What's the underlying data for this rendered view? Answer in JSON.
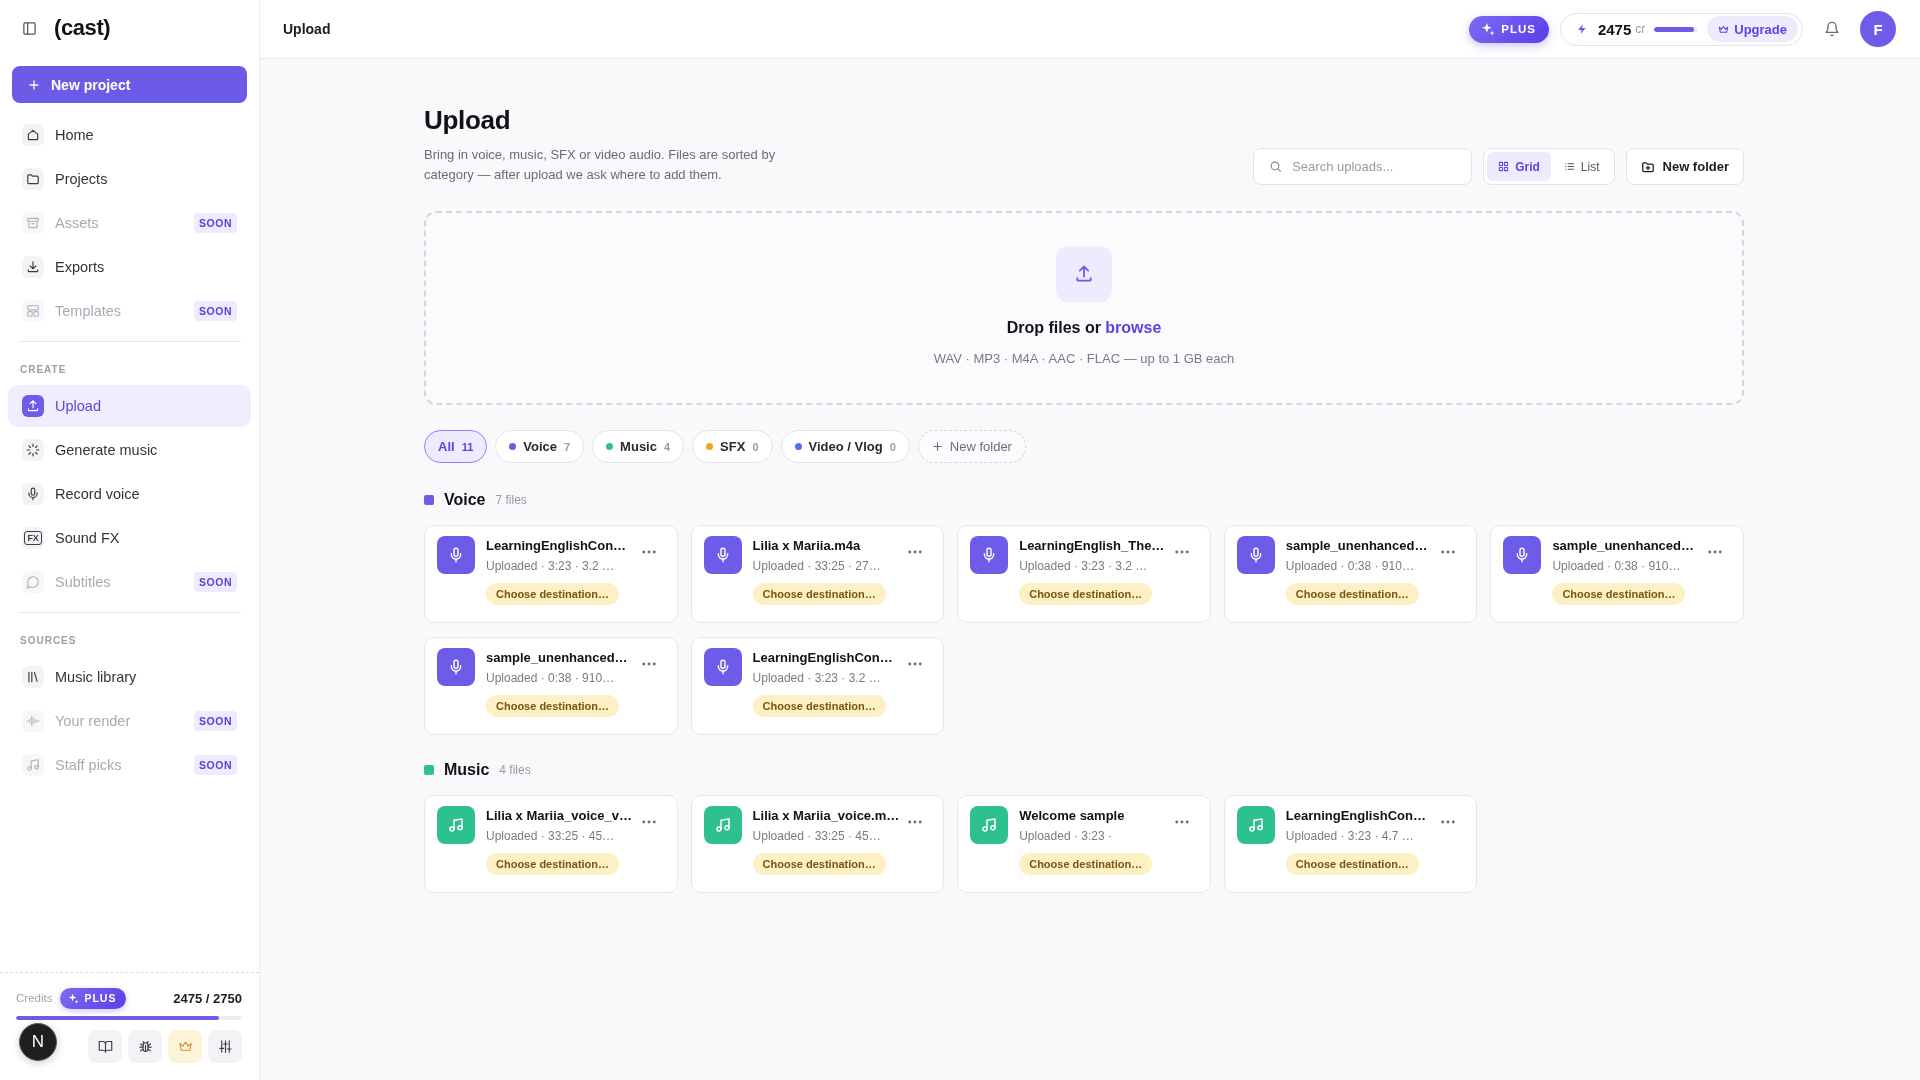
{
  "sidebar": {
    "logo": "(cast)",
    "new_project": "New project",
    "groups": [
      {
        "items": [
          {
            "label": "Home",
            "selected": false,
            "disabled": false
          },
          {
            "label": "Projects",
            "selected": false,
            "disabled": false
          },
          {
            "label": "Assets",
            "selected": false,
            "disabled": true,
            "badge": "SOON"
          },
          {
            "label": "Exports",
            "selected": false,
            "disabled": false
          },
          {
            "label": "Templates",
            "selected": false,
            "disabled": true,
            "badge": "SOON"
          }
        ]
      },
      {
        "heading": "CREATE",
        "items": [
          {
            "label": "Upload",
            "selected": true,
            "disabled": false
          },
          {
            "label": "Generate music",
            "selected": false,
            "disabled": false
          },
          {
            "label": "Record voice",
            "selected": false,
            "disabled": false
          },
          {
            "label": "Sound FX",
            "selected": false,
            "disabled": false,
            "icon_text": "FX"
          },
          {
            "label": "Subtitles",
            "selected": false,
            "disabled": true,
            "badge": "SOON"
          }
        ]
      },
      {
        "heading": "SOURCES",
        "items": [
          {
            "label": "Music library",
            "selected": false,
            "disabled": false
          },
          {
            "label": "Your render",
            "selected": false,
            "disabled": true,
            "badge": "SOON"
          },
          {
            "label": "Staff picks",
            "selected": false,
            "disabled": true,
            "badge": "SOON"
          }
        ]
      }
    ],
    "credits": {
      "label": "Credits",
      "plan": "PLUS",
      "amount": "2475 / 2750",
      "level": 0.9
    },
    "dev_avatar": "N"
  },
  "topbar": {
    "title": "Upload",
    "plan": "PLUS",
    "credits": "2475",
    "unit": "cr",
    "level": 0.9,
    "upgrade": "Upgrade",
    "avatar": "F"
  },
  "header": {
    "title": "Upload",
    "description": "Bring in voice, music, SFX or video audio. Files are sorted by category — after upload we ask where to add them.",
    "search": {
      "placeholder": "Search uploads..."
    },
    "views": [
      {
        "label": "Grid",
        "selected": true
      },
      {
        "label": "List",
        "selected": false
      }
    ],
    "new_folder": "New folder"
  },
  "drop_zone": {
    "prompt": "Drop files or",
    "link": "browse",
    "formats": "WAV · MP3 · M4A · AAC · FLAC — up to 1 GB each"
  },
  "filters": [
    {
      "label": "All",
      "count": "11",
      "selected": true
    },
    {
      "label": "Voice",
      "count": "7",
      "color": "#6c5ce7",
      "selected": false
    },
    {
      "label": "Music",
      "count": "4",
      "color": "#2ec18f",
      "selected": false
    },
    {
      "label": "SFX",
      "count": "0",
      "color": "#f0a323",
      "selected": false
    },
    {
      "label": "Video / Vlog",
      "count": "0",
      "color": "#4f6ef5",
      "selected": false
    }
  ],
  "new_folder_chip": "New folder",
  "sections": [
    {
      "title": "Voice",
      "count": "7 files",
      "kind": "voice",
      "color": "#6c5ce7",
      "files": [
        {
          "name": "LearningEnglishCon…",
          "meta": "Uploaded · 3:23 · 3.2 …",
          "action": "Choose destination…"
        },
        {
          "name": "Lilia x Mariia.m4a",
          "meta": "Uploaded · 33:25 · 27…",
          "action": "Choose destination…"
        },
        {
          "name": "LearningEnglish_The…",
          "meta": "Uploaded · 3:23 · 3.2 …",
          "action": "Choose destination…"
        },
        {
          "name": "sample_unenhanced…",
          "meta": "Uploaded · 0:38 · 910…",
          "action": "Choose destination…"
        },
        {
          "name": "sample_unenhanced…",
          "meta": "Uploaded · 0:38 · 910…",
          "action": "Choose destination…"
        },
        {
          "name": "sample_unenhanced…",
          "meta": "Uploaded · 0:38 · 910…",
          "action": "Choose destination…"
        },
        {
          "name": "LearningEnglishCon…",
          "meta": "Uploaded · 3:23 · 3.2 …",
          "action": "Choose destination…"
        }
      ]
    },
    {
      "title": "Music",
      "count": "4 files",
      "kind": "music",
      "color": "#2ec18f",
      "files": [
        {
          "name": "Lilia x Mariia_voice_v…",
          "meta": "Uploaded · 33:25 · 45…",
          "action": "Choose destination…"
        },
        {
          "name": "Lilia x Mariia_voice.m…",
          "meta": "Uploaded · 33:25 · 45…",
          "action": "Choose destination…"
        },
        {
          "name": "Welcome sample",
          "meta": "Uploaded · 3:23 ·",
          "action": "Choose destination…"
        },
        {
          "name": "LearningEnglishCon…",
          "meta": "Uploaded · 3:23 · 4.7 …",
          "action": "Choose destination…"
        }
      ]
    }
  ]
}
